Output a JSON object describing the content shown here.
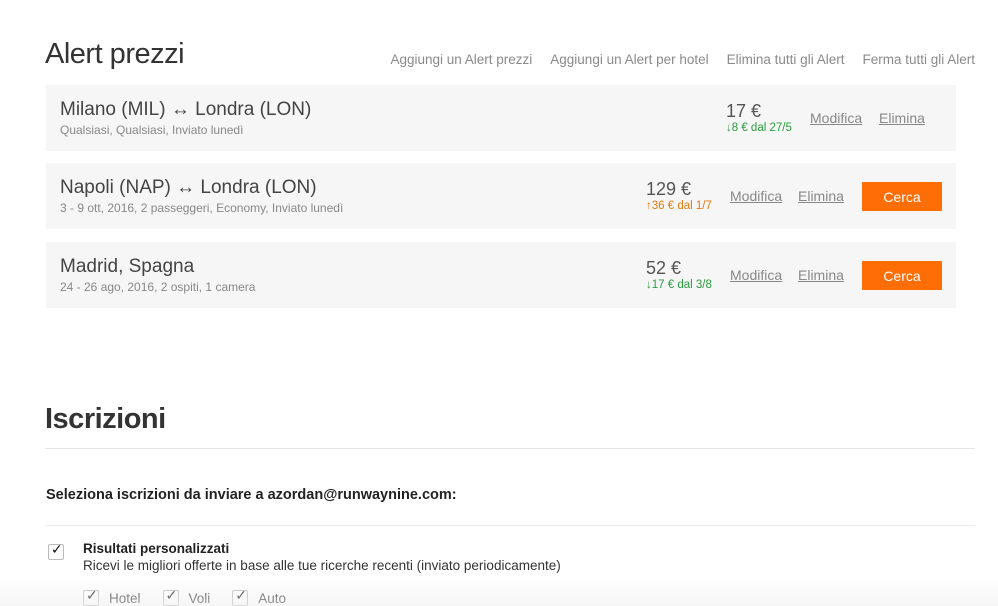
{
  "page_title": "Alert prezzi",
  "top_actions": [
    "Aggiungi un Alert prezzi",
    "Aggiungi un Alert per hotel",
    "Elimina tutti gli Alert",
    "Ferma tutti gli Alert"
  ],
  "alerts": [
    {
      "route": "Milano (MIL) ↔ Londra (LON)",
      "details": "Qualsiasi, Qualsiasi, Inviato lunedì",
      "price": "17 €",
      "delta_arrow": "↓",
      "delta_text": "8 € dal 27/5",
      "delta_direction": "down",
      "edit_label": "Modifica",
      "delete_label": "Elimina"
    },
    {
      "route": "Napoli (NAP) ↔ Londra (LON)",
      "details": "3 - 9 ott, 2016, 2 passeggeri, Economy, Inviato lunedì",
      "price": "129 €",
      "delta_arrow": "↑",
      "delta_text": "36 € dal 1/7",
      "delta_direction": "up",
      "edit_label": "Modifica",
      "delete_label": "Elimina",
      "search_label": "Cerca"
    },
    {
      "route": "Madrid, Spagna",
      "details": "24 - 26 ago, 2016, 2 ospiti, 1 camera",
      "price": "52 €",
      "delta_arrow": "↓",
      "delta_text": "17 € dal 3/8",
      "delta_direction": "down",
      "edit_label": "Modifica",
      "delete_label": "Elimina",
      "search_label": "Cerca"
    }
  ],
  "subscriptions": {
    "title": "Iscrizioni",
    "select_label": "Seleziona iscrizioni da inviare a azordan@runwaynine.com:",
    "option_title": "Risultati personalizzati",
    "option_desc": "Ricevi le migliori offerte in base alle tue ricerche recenti (inviato periodicamente)",
    "option_checked": true,
    "sub_options": [
      {
        "label": "Hotel",
        "checked": true
      },
      {
        "label": "Voli",
        "checked": true
      },
      {
        "label": "Auto",
        "checked": true
      }
    ]
  },
  "colors": {
    "accent": "#ff6d05",
    "price_down": "#2b9b3f",
    "price_up": "#e07b12",
    "row_bg": "#f6f6f6"
  }
}
